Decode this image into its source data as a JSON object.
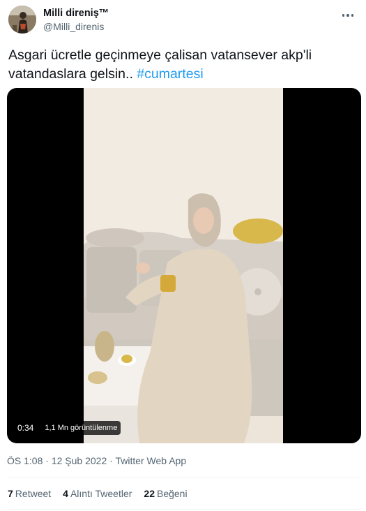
{
  "author": {
    "display_name": "Milli direniş™",
    "handle": "@Milli_direnis",
    "avatar_icon": "profile-avatar"
  },
  "tweet": {
    "text": "Asgari ücretle geçinmeye çalisan vatansever akp'li vatandaslara gelsin.. ",
    "hashtag": "#cumartesi"
  },
  "video": {
    "duration": "0:34",
    "views": "1,1 Mn görüntülenme"
  },
  "meta": {
    "time": "ÖS 1:08",
    "separator": " · ",
    "date": "12 Şub 2022",
    "source": "Twitter Web App"
  },
  "stats": [
    {
      "count": "7",
      "label": "Retweet"
    },
    {
      "count": "4",
      "label": "Alıntı Tweetler"
    },
    {
      "count": "22",
      "label": "Beğeni"
    }
  ],
  "colors": {
    "link": "#1d9bf0",
    "secondary": "#536471",
    "primary": "#0f1419"
  }
}
